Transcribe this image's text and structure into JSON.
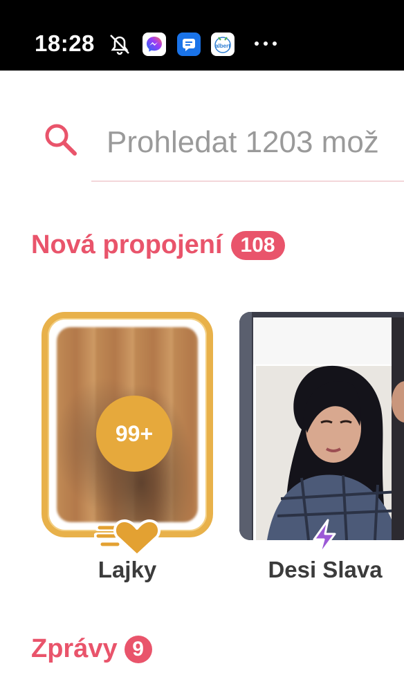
{
  "status_bar": {
    "time": "18:28",
    "icons": [
      "mute-icon",
      "messenger-icon",
      "messages-icon",
      "albert-icon",
      "more-icon"
    ],
    "albert_label": "albert"
  },
  "search": {
    "placeholder": "Prohledat 1203 mož"
  },
  "new_matches": {
    "title": "Nová propojení",
    "count": "108",
    "items": [
      {
        "label": "Lajky",
        "count": "99+"
      },
      {
        "label": "Desi Slava"
      }
    ]
  },
  "messages": {
    "title": "Zprávy",
    "count": "9"
  },
  "colors": {
    "accent": "#e9546b",
    "gold": "#e8b14a",
    "boost": "#9b59d6"
  }
}
